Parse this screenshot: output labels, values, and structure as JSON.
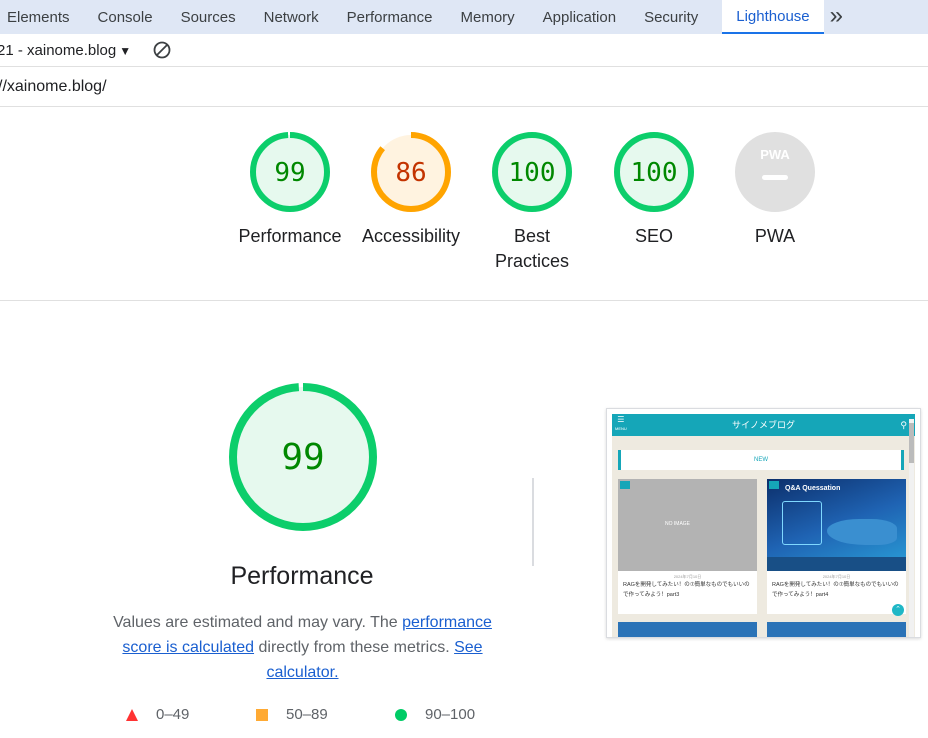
{
  "devtools": {
    "tabs": [
      "Elements",
      "Console",
      "Sources",
      "Network",
      "Performance",
      "Memory",
      "Application",
      "Security"
    ],
    "active_tab": "Lighthouse",
    "more_icon": "chevron-double-right-icon"
  },
  "report": {
    "selector_label": "21 - xainome.blog",
    "url": "//xainome.blog/"
  },
  "categories": [
    {
      "label": "Performance",
      "score": "99",
      "status": "pass"
    },
    {
      "label": "Accessibility",
      "score": "86",
      "status": "average"
    },
    {
      "label": "Best Practices",
      "score": "100",
      "status": "pass"
    },
    {
      "label": "SEO",
      "score": "100",
      "status": "pass"
    },
    {
      "label": "PWA",
      "score": "",
      "status": "na",
      "badge": "PWA"
    }
  ],
  "performance": {
    "score": "99",
    "title": "Performance",
    "desc_prefix": "Values are estimated and may vary. The ",
    "desc_link1": "performance score is calculated",
    "desc_mid": " directly from these metrics. ",
    "desc_link2": "See calculator."
  },
  "legend": [
    {
      "range": "0–49",
      "shape": "triangle",
      "color": "#f33"
    },
    {
      "range": "50–89",
      "shape": "square",
      "color": "#fa3"
    },
    {
      "range": "90–100",
      "shape": "circle",
      "color": "#0c6"
    }
  ],
  "thumbnail": {
    "site_title": "サイノメブログ",
    "menu_label": "MENU",
    "new_label": "NEW",
    "card1": {
      "image_text": "NO IMAGE",
      "date": "2024年7月10日",
      "text": "RAGを開発してみたい！の⑦簡単なものでもいいので作ってみよう！part3"
    },
    "card2": {
      "image_text": "Q&A Quessation",
      "date": "2024年7月10日",
      "text": "RAGを開発してみたい！の⑦簡単なものでもいいので作ってみよう！part4"
    }
  },
  "colors": {
    "pass": "#0cce6b",
    "pass_fill": "#e6f9ee",
    "pass_text": "#008800",
    "average": "#ffa400",
    "average_fill": "#fff3e0",
    "average_text": "#c33300",
    "na": "#e0e0e0"
  }
}
